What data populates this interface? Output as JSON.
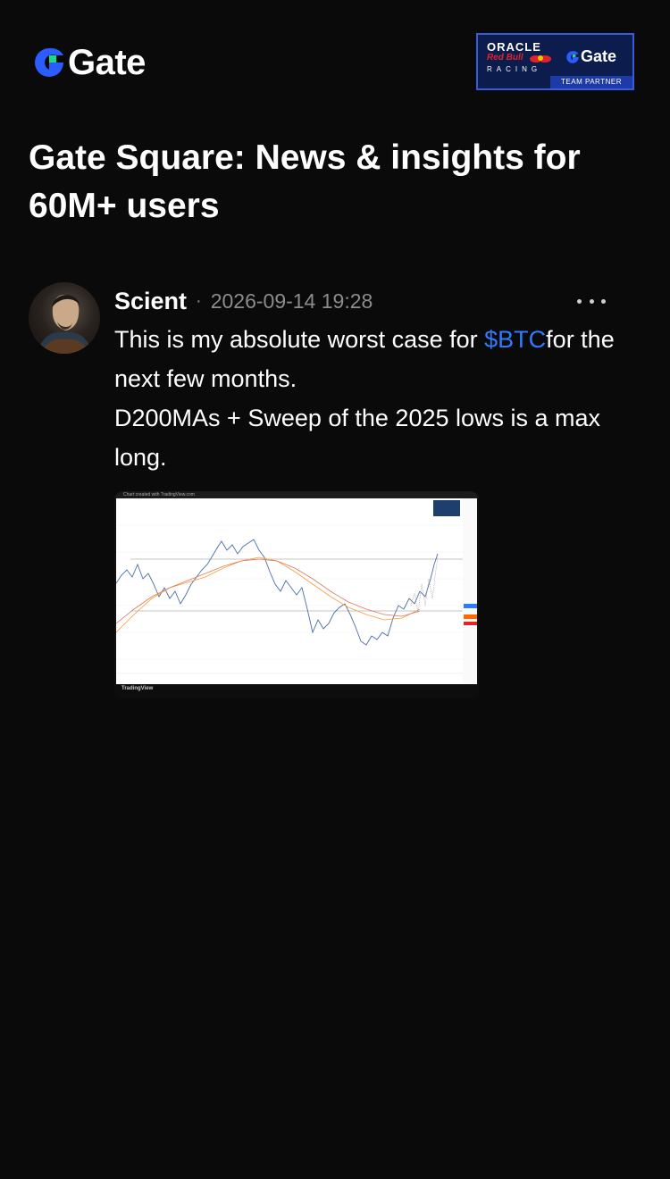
{
  "header": {
    "brand": "Gate",
    "partner": {
      "oracle": "ORACLE",
      "redbull": "Red Bull",
      "racing": "RACING",
      "brand": "Gate",
      "badge": "TEAM PARTNER"
    }
  },
  "page": {
    "title": "Gate Square: News & insights for 60M+ users"
  },
  "post": {
    "author": "Scient",
    "separator": "·",
    "timestamp": "2026-09-14 19:28",
    "text_before": "This is my absolute worst case for ",
    "ticker": "$BTC",
    "text_after": "for the next few months.",
    "line2": "D200MAs + Sweep of the 2025 lows is a max long.",
    "image": {
      "source_label": "TradingView",
      "caption_top": "Chart created with TradingView.com"
    }
  },
  "colors": {
    "background": "#0a0a0a",
    "accent": "#2f7bff",
    "muted": "#8c8c8c"
  },
  "icons": {
    "brand": "gate-logo-icon",
    "more": "more-dots-icon"
  }
}
